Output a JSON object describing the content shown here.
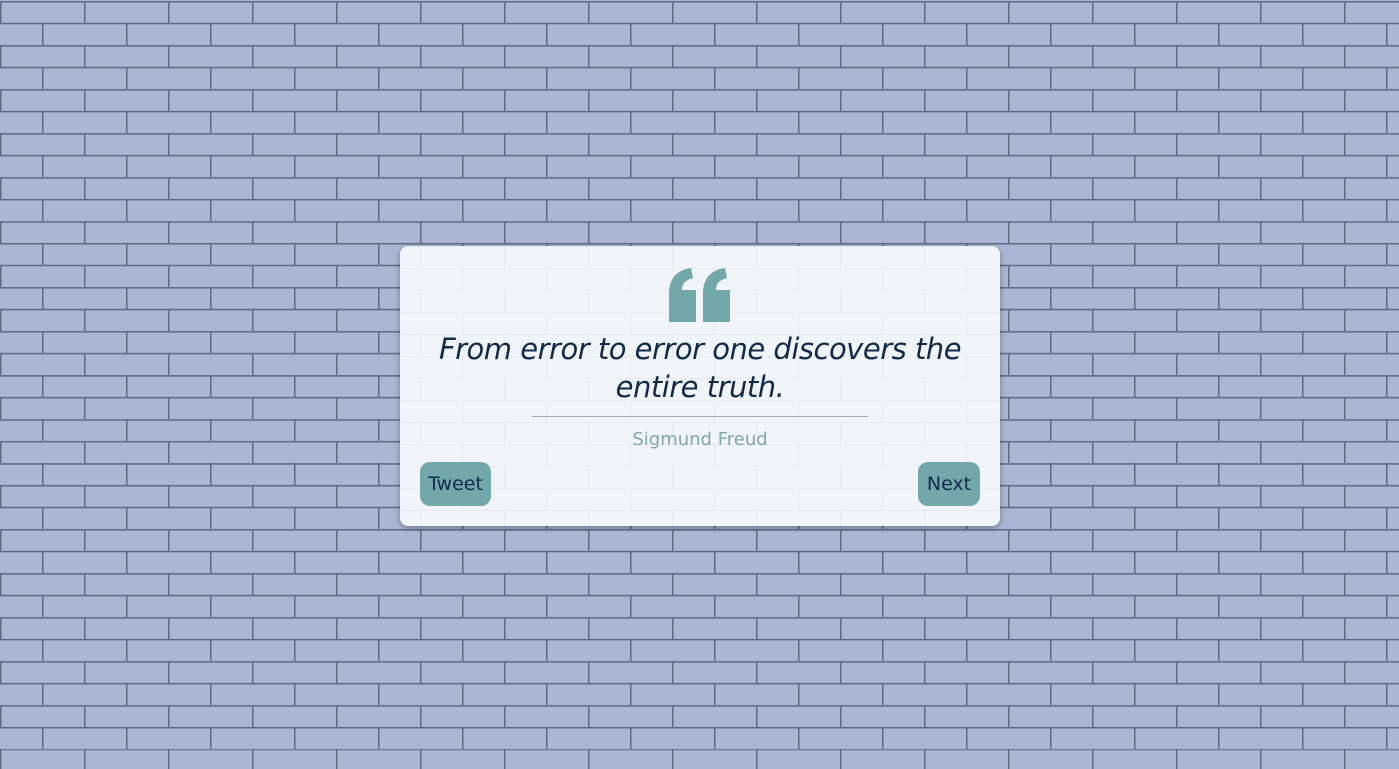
{
  "colors": {
    "wall": "#a9b7d4",
    "mortar": "#5e6a7e",
    "card": "#f1f4f8",
    "accent": "#73a8ab",
    "text": "#0f2a4a",
    "author": "#7fa8ab"
  },
  "quote": {
    "icon": "quote-left-icon",
    "text": "From error to error one discovers the entire truth.",
    "author": "Sigmund Freud"
  },
  "buttons": {
    "tweet_label": "Tweet",
    "next_label": "Next"
  }
}
